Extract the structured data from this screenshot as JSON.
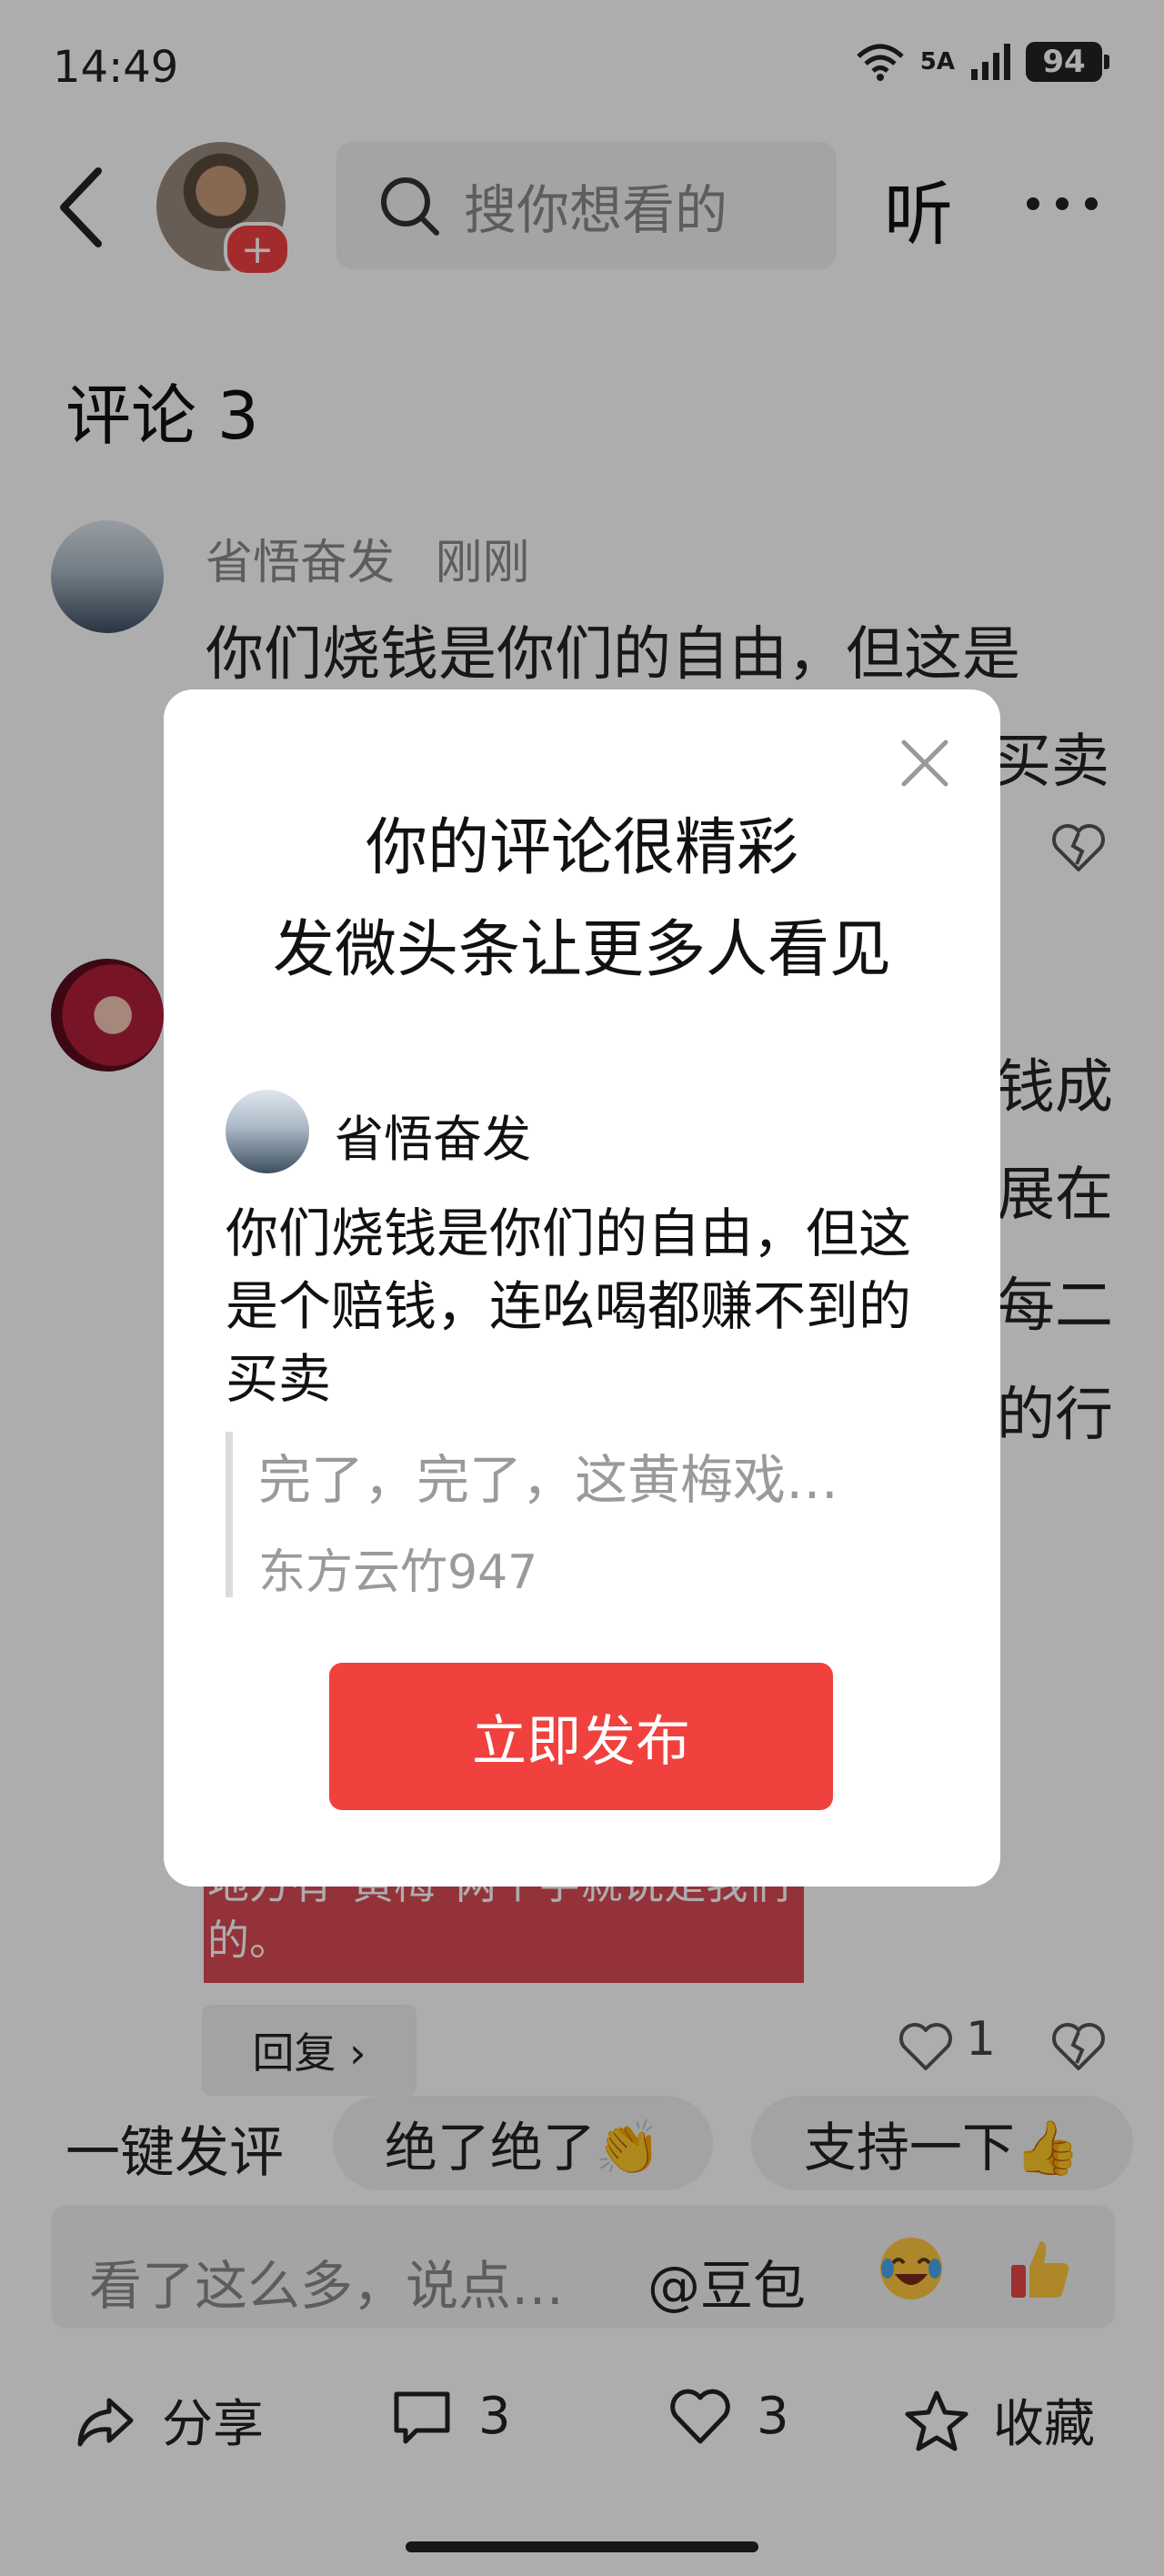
{
  "status_bar": {
    "time": "14:49",
    "network": "5A",
    "battery": "94"
  },
  "header": {
    "search_placeholder": "搜你想看的",
    "listen_label": "听",
    "follow_plus": "+"
  },
  "comments": {
    "title": "评论 3",
    "items": [
      {
        "user": "省悟奋发",
        "time": "刚刚",
        "text_line1": "你们烧钱是你们的自由，但这是",
        "text_tail": "买卖"
      },
      {
        "side_fragments": [
          "钱成",
          "展在",
          "每二",
          "的行"
        ]
      }
    ],
    "card_text_line1": "地方有\"黄梅\"两个字就说是我们",
    "card_text_line2": "的。",
    "reply_label": "回复 ›",
    "like_count": "1"
  },
  "quick_replies": {
    "label": "一键发评",
    "chips": [
      "绝了绝了👏",
      "支持一下👍"
    ]
  },
  "input": {
    "placeholder": "看了这么多，说点…",
    "doubao": "@豆包"
  },
  "bottom_bar": {
    "share": "分享",
    "comment_count": "3",
    "like_count": "3",
    "favorite": "收藏"
  },
  "dialog": {
    "title_line1": "你的评论很精彩",
    "title_line2": "发微头条让更多人看见",
    "user": "省悟奋发",
    "comment_text": "你们烧钱是你们的自由，但这是个赔钱，连吆喝都赚不到的买卖",
    "quote_text": "完了，完了，这黄梅戏…",
    "quote_user": "东方云竹947",
    "publish_label": "立即发布"
  },
  "colors": {
    "accent_red": "#f0413e",
    "overlay": "rgba(0,0,0,0.32)"
  }
}
